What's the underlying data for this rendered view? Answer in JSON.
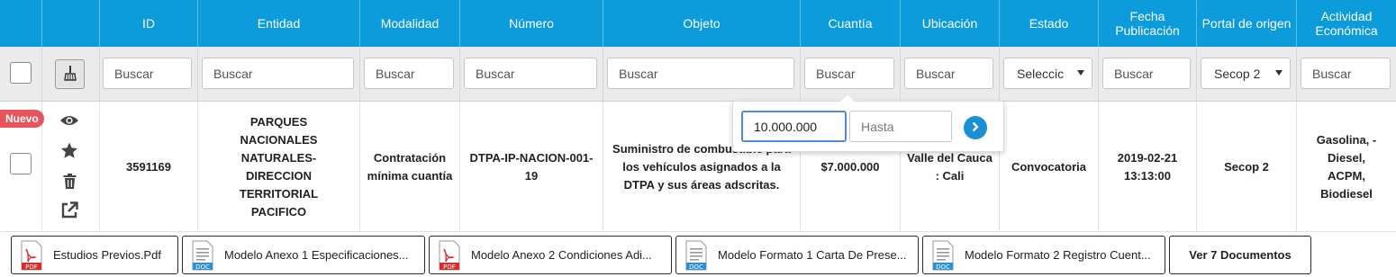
{
  "header": {
    "columns": [
      "ID",
      "Entidad",
      "Modalidad",
      "Número",
      "Objeto",
      "Cuantía",
      "Ubicación",
      "Estado",
      "Fecha Publicación",
      "Portal de origen",
      "Actividad Económica"
    ]
  },
  "filters": {
    "placeholder": "Buscar",
    "estado_selected": "Seleccic",
    "portal_selected": "Secop 2"
  },
  "row": {
    "badge": "Nuevo",
    "id": "3591169",
    "entidad": "PARQUES NACIONALES NATURALES- DIRECCION TERRITORIAL PACIFICO",
    "modalidad": "Contratación mínima cuantía",
    "numero": "DTPA-IP-NACION-001-19",
    "objeto": "Suministro de combustible para los vehículos asignados a la DTPA y sus áreas adscritas.",
    "cuantia": "$7.000.000",
    "ubicacion": "Valle del Cauca : Cali",
    "estado": "Convocatoria",
    "fecha": "2019-02-21 13:13:00",
    "portal": "Secop 2",
    "actividad": "Gasolina, - Diesel, ACPM, Biodiesel"
  },
  "range_popup": {
    "from_value": "10.000.000",
    "to_placeholder": "Hasta"
  },
  "documents": [
    {
      "label": "Estudios Previos.Pdf",
      "type": "PDF"
    },
    {
      "label": "Modelo Anexo 1 Especificaciones...",
      "type": "DOC"
    },
    {
      "label": "Modelo Anexo 2 Condiciones Adi...",
      "type": "PDF"
    },
    {
      "label": "Modelo Formato 1 Carta De Prese...",
      "type": "DOC"
    },
    {
      "label": "Modelo Formato 2 Registro Cuent...",
      "type": "DOC"
    }
  ],
  "more_documents": "Ver 7 Documentos",
  "colors": {
    "header_bg": "#0c9cdb",
    "badge_bg": "#e8545c",
    "go_button": "#1a8fd4",
    "icons": "#444444"
  },
  "icons": [
    "eye-icon",
    "star-icon",
    "trash-icon",
    "external-link-icon",
    "broom-icon",
    "chevron-right-icon",
    "pdf-file-icon",
    "doc-file-icon",
    "dropdown-caret-icon"
  ]
}
